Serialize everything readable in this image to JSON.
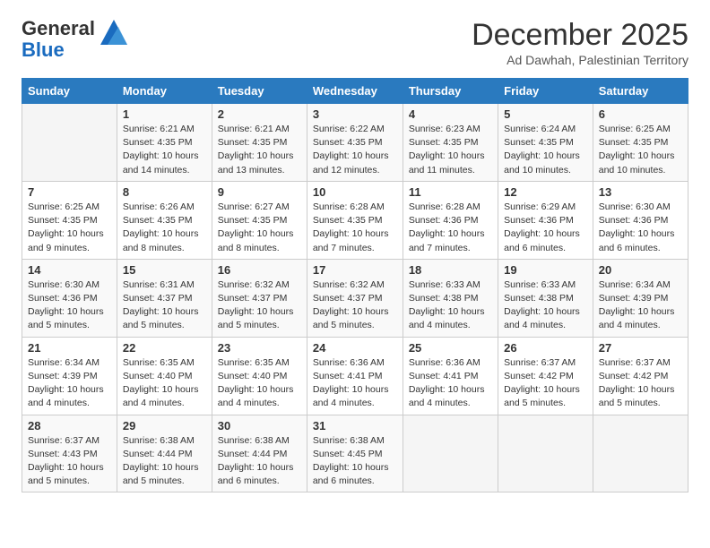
{
  "header": {
    "logo_general": "General",
    "logo_blue": "Blue",
    "title": "December 2025",
    "subtitle": "Ad Dawhah, Palestinian Territory"
  },
  "calendar": {
    "days_of_week": [
      "Sunday",
      "Monday",
      "Tuesday",
      "Wednesday",
      "Thursday",
      "Friday",
      "Saturday"
    ],
    "weeks": [
      [
        {
          "day": "",
          "info": ""
        },
        {
          "day": "1",
          "info": "Sunrise: 6:21 AM\nSunset: 4:35 PM\nDaylight: 10 hours\nand 14 minutes."
        },
        {
          "day": "2",
          "info": "Sunrise: 6:21 AM\nSunset: 4:35 PM\nDaylight: 10 hours\nand 13 minutes."
        },
        {
          "day": "3",
          "info": "Sunrise: 6:22 AM\nSunset: 4:35 PM\nDaylight: 10 hours\nand 12 minutes."
        },
        {
          "day": "4",
          "info": "Sunrise: 6:23 AM\nSunset: 4:35 PM\nDaylight: 10 hours\nand 11 minutes."
        },
        {
          "day": "5",
          "info": "Sunrise: 6:24 AM\nSunset: 4:35 PM\nDaylight: 10 hours\nand 10 minutes."
        },
        {
          "day": "6",
          "info": "Sunrise: 6:25 AM\nSunset: 4:35 PM\nDaylight: 10 hours\nand 10 minutes."
        }
      ],
      [
        {
          "day": "7",
          "info": "Sunrise: 6:25 AM\nSunset: 4:35 PM\nDaylight: 10 hours\nand 9 minutes."
        },
        {
          "day": "8",
          "info": "Sunrise: 6:26 AM\nSunset: 4:35 PM\nDaylight: 10 hours\nand 8 minutes."
        },
        {
          "day": "9",
          "info": "Sunrise: 6:27 AM\nSunset: 4:35 PM\nDaylight: 10 hours\nand 8 minutes."
        },
        {
          "day": "10",
          "info": "Sunrise: 6:28 AM\nSunset: 4:35 PM\nDaylight: 10 hours\nand 7 minutes."
        },
        {
          "day": "11",
          "info": "Sunrise: 6:28 AM\nSunset: 4:36 PM\nDaylight: 10 hours\nand 7 minutes."
        },
        {
          "day": "12",
          "info": "Sunrise: 6:29 AM\nSunset: 4:36 PM\nDaylight: 10 hours\nand 6 minutes."
        },
        {
          "day": "13",
          "info": "Sunrise: 6:30 AM\nSunset: 4:36 PM\nDaylight: 10 hours\nand 6 minutes."
        }
      ],
      [
        {
          "day": "14",
          "info": "Sunrise: 6:30 AM\nSunset: 4:36 PM\nDaylight: 10 hours\nand 5 minutes."
        },
        {
          "day": "15",
          "info": "Sunrise: 6:31 AM\nSunset: 4:37 PM\nDaylight: 10 hours\nand 5 minutes."
        },
        {
          "day": "16",
          "info": "Sunrise: 6:32 AM\nSunset: 4:37 PM\nDaylight: 10 hours\nand 5 minutes."
        },
        {
          "day": "17",
          "info": "Sunrise: 6:32 AM\nSunset: 4:37 PM\nDaylight: 10 hours\nand 5 minutes."
        },
        {
          "day": "18",
          "info": "Sunrise: 6:33 AM\nSunset: 4:38 PM\nDaylight: 10 hours\nand 4 minutes."
        },
        {
          "day": "19",
          "info": "Sunrise: 6:33 AM\nSunset: 4:38 PM\nDaylight: 10 hours\nand 4 minutes."
        },
        {
          "day": "20",
          "info": "Sunrise: 6:34 AM\nSunset: 4:39 PM\nDaylight: 10 hours\nand 4 minutes."
        }
      ],
      [
        {
          "day": "21",
          "info": "Sunrise: 6:34 AM\nSunset: 4:39 PM\nDaylight: 10 hours\nand 4 minutes."
        },
        {
          "day": "22",
          "info": "Sunrise: 6:35 AM\nSunset: 4:40 PM\nDaylight: 10 hours\nand 4 minutes."
        },
        {
          "day": "23",
          "info": "Sunrise: 6:35 AM\nSunset: 4:40 PM\nDaylight: 10 hours\nand 4 minutes."
        },
        {
          "day": "24",
          "info": "Sunrise: 6:36 AM\nSunset: 4:41 PM\nDaylight: 10 hours\nand 4 minutes."
        },
        {
          "day": "25",
          "info": "Sunrise: 6:36 AM\nSunset: 4:41 PM\nDaylight: 10 hours\nand 4 minutes."
        },
        {
          "day": "26",
          "info": "Sunrise: 6:37 AM\nSunset: 4:42 PM\nDaylight: 10 hours\nand 5 minutes."
        },
        {
          "day": "27",
          "info": "Sunrise: 6:37 AM\nSunset: 4:42 PM\nDaylight: 10 hours\nand 5 minutes."
        }
      ],
      [
        {
          "day": "28",
          "info": "Sunrise: 6:37 AM\nSunset: 4:43 PM\nDaylight: 10 hours\nand 5 minutes."
        },
        {
          "day": "29",
          "info": "Sunrise: 6:38 AM\nSunset: 4:44 PM\nDaylight: 10 hours\nand 5 minutes."
        },
        {
          "day": "30",
          "info": "Sunrise: 6:38 AM\nSunset: 4:44 PM\nDaylight: 10 hours\nand 6 minutes."
        },
        {
          "day": "31",
          "info": "Sunrise: 6:38 AM\nSunset: 4:45 PM\nDaylight: 10 hours\nand 6 minutes."
        },
        {
          "day": "",
          "info": ""
        },
        {
          "day": "",
          "info": ""
        },
        {
          "day": "",
          "info": ""
        }
      ]
    ]
  }
}
